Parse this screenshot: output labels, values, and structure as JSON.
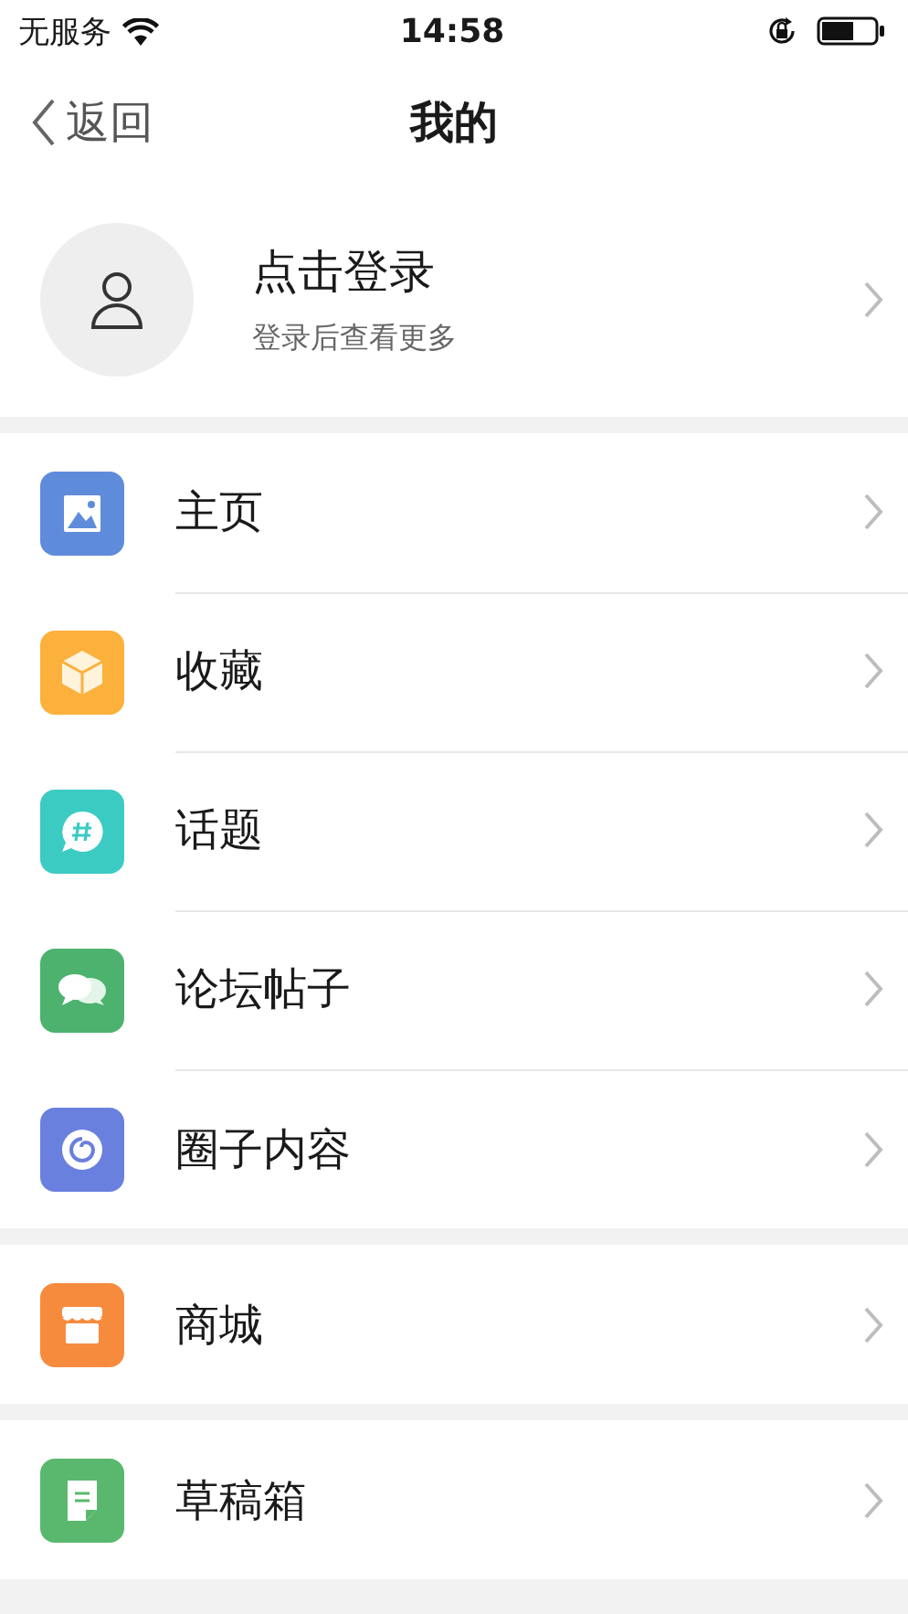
{
  "status_bar": {
    "carrier": "无服务",
    "time": "14:58"
  },
  "nav": {
    "back": "返回",
    "title": "我的"
  },
  "profile": {
    "title": "点击登录",
    "subtitle": "登录后查看更多"
  },
  "groups": [
    {
      "items": [
        {
          "label": "主页",
          "kind": "image"
        },
        {
          "label": "收藏",
          "kind": "cube"
        },
        {
          "label": "话题",
          "kind": "hash"
        },
        {
          "label": "论坛帖子",
          "kind": "chat"
        },
        {
          "label": "圈子内容",
          "kind": "swirl"
        }
      ]
    },
    {
      "items": [
        {
          "label": "商城",
          "kind": "shop"
        }
      ]
    },
    {
      "items": [
        {
          "label": "草稿箱",
          "kind": "draft"
        }
      ]
    }
  ]
}
